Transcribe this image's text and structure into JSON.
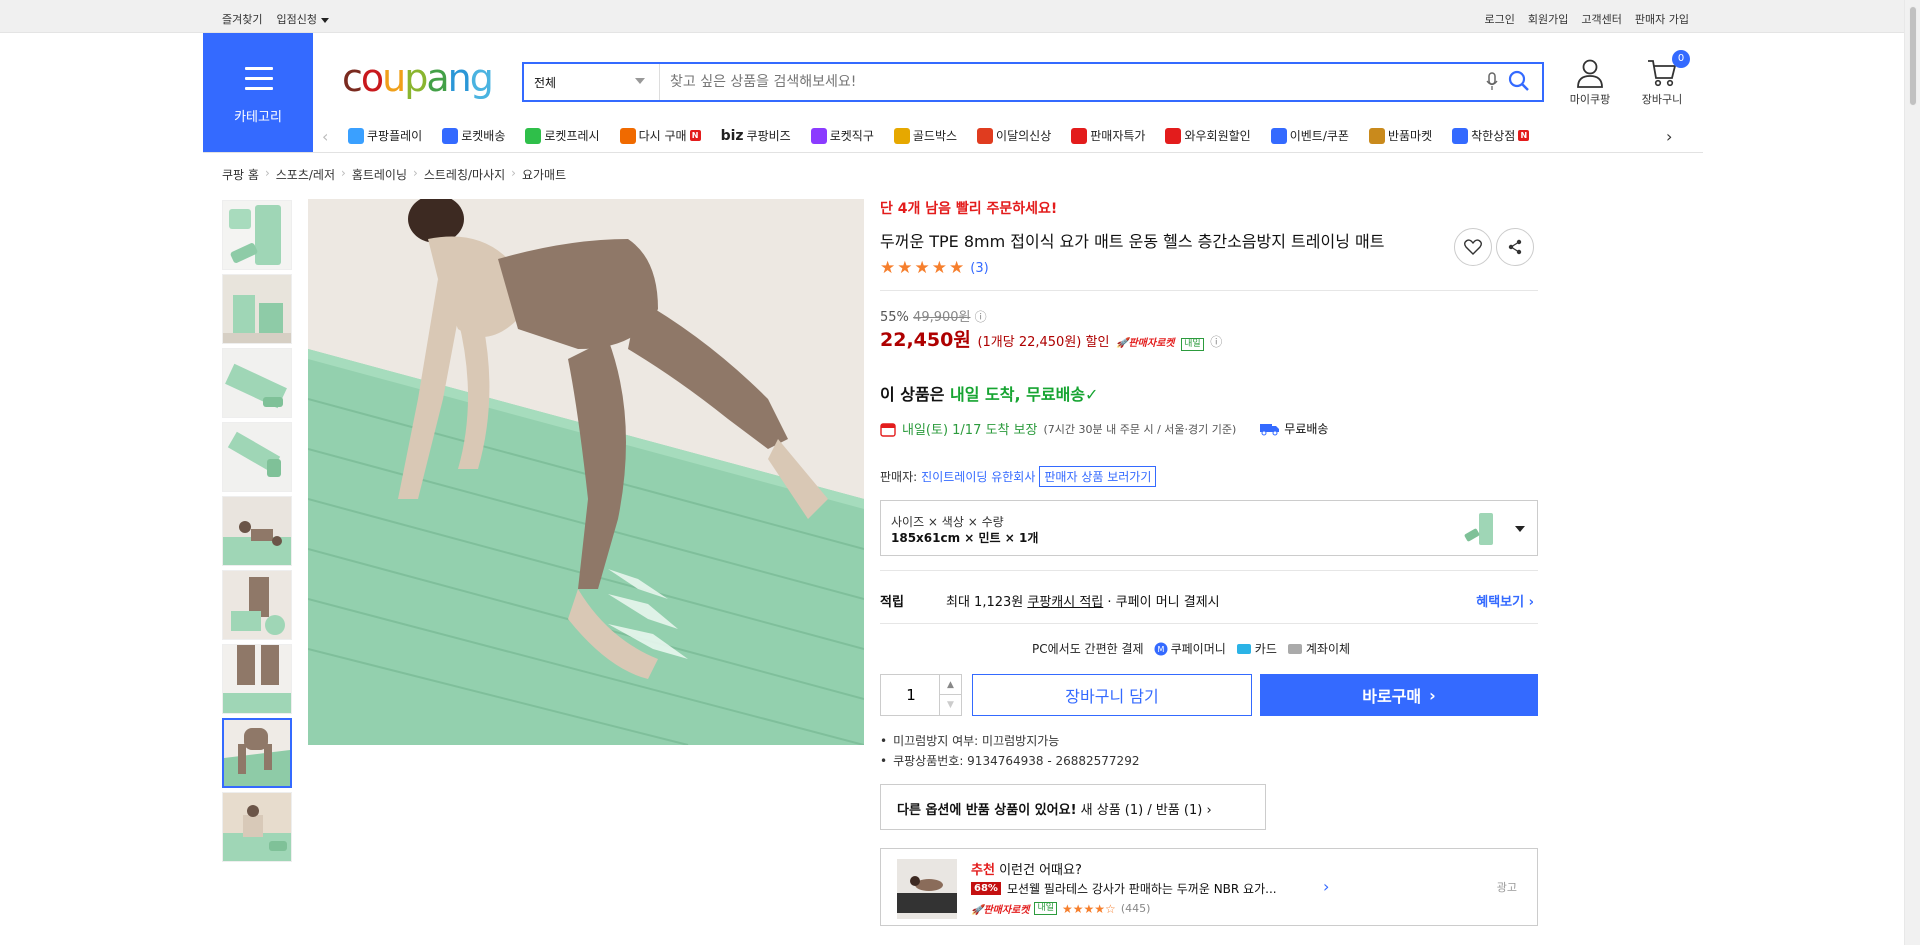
{
  "topbar": {
    "left": [
      "즐겨찾기",
      "입점신청"
    ],
    "right": [
      "로그인",
      "회원가입",
      "고객센터",
      "판매자 가입"
    ]
  },
  "header": {
    "category_label": "카테고리",
    "logo": "coupang",
    "search_select": "전체",
    "search_placeholder": "찾고 싶은 상품을 검색해보세요!",
    "my_label": "마이쿠팡",
    "cart_label": "장바구니",
    "cart_count": "0"
  },
  "nav": [
    {
      "label": "쿠팡플레이",
      "icon": "play-icon",
      "color": "#3aa0ff"
    },
    {
      "label": "로켓배송",
      "icon": "rocket-icon",
      "color": "#346aff"
    },
    {
      "label": "로켓프레시",
      "icon": "rocket-fresh-icon",
      "color": "#2fbf4a"
    },
    {
      "label": "다시 구매",
      "icon": "rebuy-icon",
      "color": "#f06a00",
      "badge": "N"
    },
    {
      "label": "쿠팡비즈",
      "prefix": "biz",
      "icon": "biz-icon",
      "color": "#111"
    },
    {
      "label": "로켓직구",
      "icon": "rocket-global-icon",
      "color": "#8b3bff"
    },
    {
      "label": "골드박스",
      "icon": "goldbox-icon",
      "color": "#e6a800"
    },
    {
      "label": "이달의신상",
      "icon": "new-icon",
      "color": "#e03c1f"
    },
    {
      "label": "판매자특가",
      "icon": "percent-icon",
      "color": "#e31c1c"
    },
    {
      "label": "와우회원할인",
      "icon": "wow-icon",
      "color": "#e31c1c"
    },
    {
      "label": "이벤트/쿠폰",
      "icon": "coupon-icon",
      "color": "#346aff"
    },
    {
      "label": "반품마켓",
      "icon": "market-icon",
      "color": "#c98a1c"
    },
    {
      "label": "착한상점",
      "icon": "shop-icon",
      "color": "#346aff",
      "badge": "N"
    }
  ],
  "breadcrumb": [
    "쿠팡 홈",
    "스포츠/레저",
    "홈트레이닝",
    "스트레칭/마사지",
    "요가매트"
  ],
  "product": {
    "hurry": "단 4개 남음 빨리 주문하세요!",
    "title": "두꺼운 TPE 8mm 접이식 요가 매트 운동 헬스 층간소음방지 트레이닝 매트",
    "review_count": "(3)",
    "discount": "55%",
    "original_price": "49,900원",
    "price": "22,450원",
    "unit_price": "(1개당 22,450원) 할인",
    "rocket_label": "판매자로켓",
    "tomorrow_label": "내일",
    "arrival_prefix": "이 상품은",
    "arrival_highlight": "내일 도착, 무료배송",
    "delivery_date": "내일(토) 1/17 도착 보장",
    "delivery_note": "(7시간 30분 내 주문 시 / 서울·경기 기준)",
    "free_shipping": "무료배송",
    "seller_label": "판매자:",
    "seller_name": "진이트레이딩 유한회사",
    "seller_link": "판매자 상품 보러가기",
    "option_header": "사이즈 × 색상 × 수량",
    "option_value": "185x61cm × 민트 × 1개",
    "earn_label": "적립",
    "earn_text1": "최대 1,123원",
    "earn_link": "쿠팡캐시 적립",
    "earn_text2": "· 쿠페이 머니 결제시",
    "earn_more": "혜택보기",
    "pay_label": "PC에서도 간편한 결제",
    "pay_methods": [
      "쿠페이머니",
      "카드",
      "계좌이체"
    ],
    "qty": "1",
    "add_cart": "장바구니 담기",
    "buy_now": "바로구매",
    "bullets": [
      "미끄럼방지 여부: 미끄럼방지가능",
      "쿠팡상품번호: 9134764938 - 26882577292"
    ],
    "option_alert_bold": "다른 옵션에 반품 상품이 있어요!",
    "option_alert_rest": "새 상품 (1) / 반품 (1)"
  },
  "recommend": {
    "tag": "추천",
    "title": "이런건 어때요?",
    "percent": "68%",
    "name": "모션웰 필라테스 강사가 판매하는 두꺼운 NBR 요가...",
    "rocket": "판매자로켓",
    "tomorrow": "내일",
    "rating": 4.5,
    "count": "(445)",
    "ad": "광고"
  },
  "colors": {
    "accent": "#346aff",
    "price": "#ae0000",
    "rocket": "#e31c1c",
    "green": "#16a431",
    "mint": "#8ecba7"
  }
}
